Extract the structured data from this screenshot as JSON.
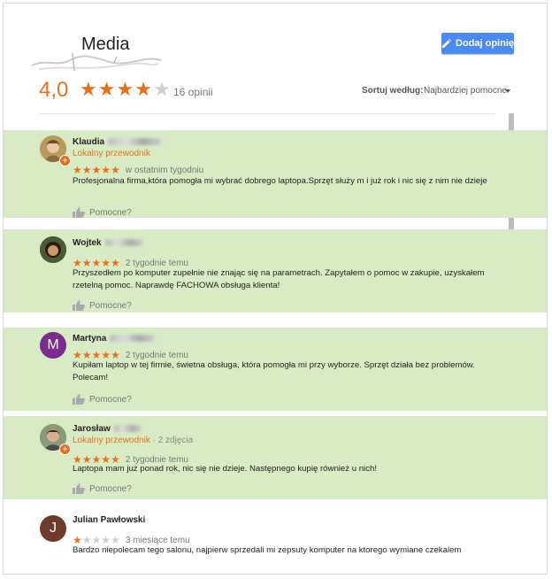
{
  "header": {
    "title": "Media",
    "add_review_label": "Dodaj opinię",
    "rating": "4,0",
    "rating_stars": 4,
    "review_count": "16 opinii",
    "sort_label": "Sortuj według:",
    "sort_value": "Najbardziej pomocne"
  },
  "colors": {
    "accent": "#e7711b",
    "highlight": "#d8ebc5",
    "button": "#4a8af4"
  },
  "reviews": [
    {
      "name": "Klaudia",
      "local_guide": "Lokalny przewodnik",
      "extra": "",
      "stars": 5,
      "date": "w ostatnim tygodniu",
      "text": "Profesjonalna firma,która  pomogła mi wybrać dobrego laptopa.Sprzęt służy m i już rok  i nic się z nim nie dzieje",
      "helpful": "Pomocne?",
      "highlighted": true
    },
    {
      "name": "Wojtek",
      "local_guide": "",
      "extra": "",
      "stars": 5,
      "date": "2 tygodnie temu",
      "text": "Przyszedłem po komputer zupełnie nie znając się na parametrach. Zapytałem o pomoc w zakupie, uzyskałem rzetelną pomoc. Naprawdę FACHOWA obsługa klienta!",
      "helpful": "Pomocne?",
      "highlighted": true
    },
    {
      "name": "Martyna",
      "avatar_letter": "M",
      "local_guide": "",
      "extra": "",
      "stars": 5,
      "date": "2 tygodnie temu",
      "text": "Kupiłam laptop w tej firmie, świetna obsługa, która pomogła mi przy wyborze. Sprzęt działa bez problemów. Polecam!",
      "helpful": "Pomocne?",
      "highlighted": true
    },
    {
      "name": "Jarosław",
      "local_guide": "Lokalny przewodnik",
      "extra": " · 2 zdjęcia",
      "stars": 5,
      "date": "2 tygodnie temu",
      "text": "Laptopa mam już ponad rok, nic się nie dzieje. Następnego kupię również u nich!",
      "helpful": "Pomocne?",
      "highlighted": true
    },
    {
      "name": "Julian Pawłowski",
      "avatar_letter": "J",
      "local_guide": "",
      "extra": "",
      "stars": 1,
      "date": "3 miesiące temu",
      "text": "Bardzo niepolecam tego salonu, najpierw sprzedali mi zepsuty komputer na ktorego wymiane czekalem",
      "helpful": "",
      "highlighted": false
    }
  ]
}
